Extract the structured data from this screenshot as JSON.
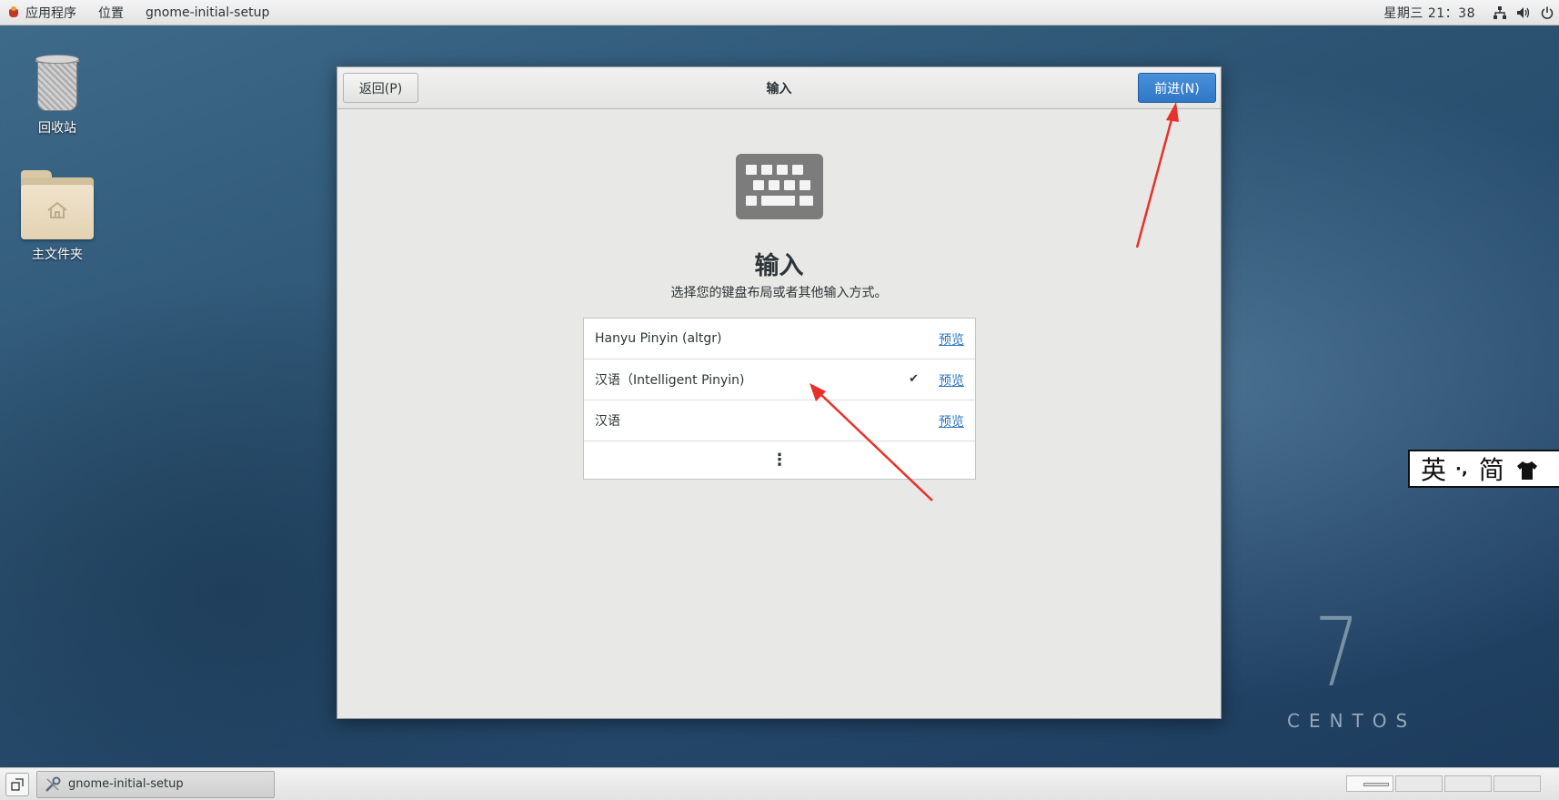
{
  "topbar": {
    "applications": "应用程序",
    "places": "位置",
    "active_app": "gnome-initial-setup",
    "clock": "星期三 21：38"
  },
  "desktop": {
    "trash_label": "回收站",
    "home_label": "主文件夹"
  },
  "dialog": {
    "back_label": "返回(P)",
    "title": "输入",
    "next_label": "前进(N)",
    "heading": "输入",
    "subtitle": "选择您的键盘布局或者其他输入方式。",
    "layouts": [
      {
        "name": "Hanyu Pinyin (altgr)",
        "preview": "预览",
        "selected": false
      },
      {
        "name": "汉语（Intelligent Pinyin)",
        "preview": "预览",
        "selected": true
      },
      {
        "name": "汉语",
        "preview": "预览",
        "selected": false
      }
    ],
    "more_glyph": "⋮",
    "check_glyph": "✔"
  },
  "ime": {
    "lang": "英",
    "punct": "·,",
    "script": "简",
    "skin_icon": "shirt-icon"
  },
  "watermark": {
    "version": "7",
    "brand": "CENTOS"
  },
  "taskbar": {
    "window_label": "gnome-initial-setup"
  },
  "colors": {
    "accent": "#2f78c8",
    "link": "#2a76c6",
    "annotation_arrow": "#e8302a"
  }
}
